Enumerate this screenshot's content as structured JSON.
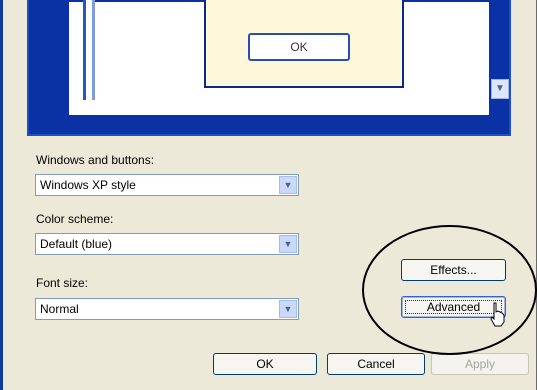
{
  "preview": {
    "ok_label": "OK",
    "scroll_arrow": "chevron-down-icon"
  },
  "fields": {
    "windows_buttons": {
      "label": "Windows and buttons:",
      "value": "Windows XP style"
    },
    "color_scheme": {
      "label": "Color scheme:",
      "value": "Default (blue)"
    },
    "font_size": {
      "label": "Font size:",
      "value": "Normal"
    }
  },
  "buttons": {
    "effects": "Effects...",
    "advanced": "Advanced",
    "ok": "OK",
    "cancel": "Cancel",
    "apply": "Apply"
  },
  "colors": {
    "dialog_bg": "#ece9d8",
    "preview_blue": "#0b32a5",
    "message_bg": "#fff7d9"
  }
}
